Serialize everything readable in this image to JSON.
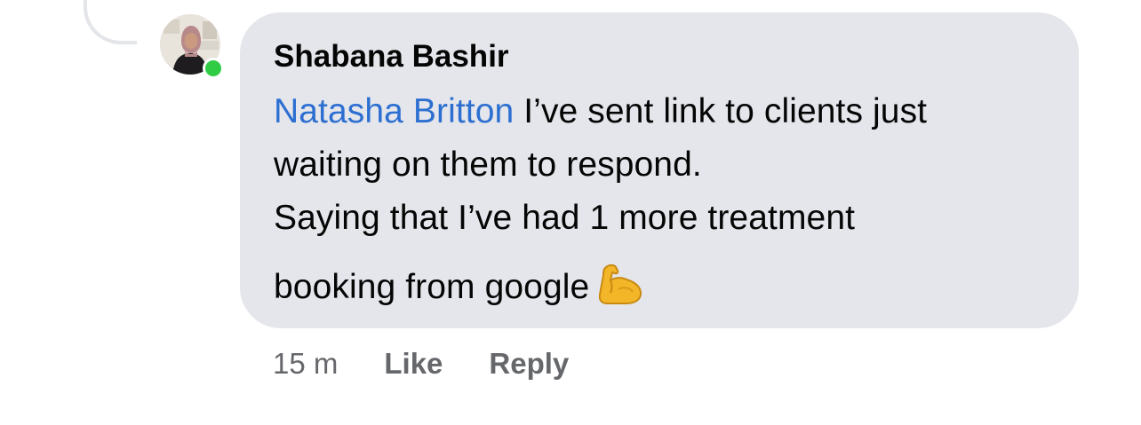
{
  "comment": {
    "author": "Shabana Bashir",
    "mention": "Natasha Britton",
    "lines": [
      " I’ve sent link to clients just",
      "waiting on them to respond.",
      "Saying that I’ve had 1 more treatment",
      "booking from google"
    ],
    "emoji": "flexed-biceps",
    "online_status_color": "#31cc46"
  },
  "actions": {
    "timestamp": "15 m",
    "like_label": "Like",
    "reply_label": "Reply"
  },
  "colors": {
    "bubble": "#e4e6eb",
    "mention": "#2d6fd1",
    "secondary_text": "#65676b"
  }
}
